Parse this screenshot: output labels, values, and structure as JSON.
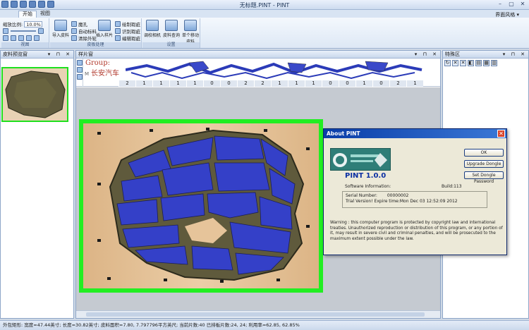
{
  "app": {
    "title": "无标题.PINT - PINT",
    "style_label": "界面风格 ▾"
  },
  "ribbon": {
    "tabs": [
      "开始",
      "视图"
    ],
    "zoom_label": "缩放比例:",
    "zoom_value": "10.0%",
    "groups": {
      "view_caption": "视图",
      "import_caption": "皮板处理",
      "camera_caption": "设置"
    },
    "buttons": {
      "import_leather": "导入皮料",
      "remove_hole": "魔孔",
      "auto_mark": "自动标料",
      "clear_outline": "清除外轮",
      "insert_piece": "插入样片",
      "draw_defect": "绘制瑕疵",
      "recognize_defect": "识别瑕疵",
      "edit_defect": "编辑瑕疵",
      "adjust_camera": "调校相机",
      "leather_inventory": "皮料查询",
      "single_move": "单个移动皮料"
    }
  },
  "left_panel": {
    "title": "皮料预览窗"
  },
  "center_panel": {
    "title": "样片窗",
    "group_label": "Group:",
    "group_name": "长安汽车",
    "strip_m": "M",
    "counts": [
      "2",
      "1",
      "1",
      "1",
      "1",
      "0",
      "0",
      "2",
      "2",
      "1",
      "1",
      "1",
      "0",
      "0",
      "1",
      "0",
      "2",
      "1"
    ]
  },
  "right_panel": {
    "title": "特殊区",
    "tools": [
      "↻",
      "✕",
      "✕",
      "◧",
      "▤",
      "▦",
      "▥"
    ]
  },
  "about": {
    "title": "About PINT",
    "close": "✕",
    "product": "PINT 1.0.0",
    "software_info": "Software Information:",
    "build": "Build:113",
    "serial_label": "Serial Number:",
    "serial_value": "00000002",
    "trial": "Trial Version! Expire time:Mon Dec 03 12:52:09 2012",
    "warning": "Warning : this computer program is protected by copyright law and international treaties. Unauthorized  reproduction or distribution of this program, or any portion of it, may result in severe civil and criminal penalties, and  will be prosecuted to the maximum extent possible under the law.",
    "buttons": {
      "ok": "OK",
      "upgrade": "Upgrade Dongle",
      "set_password": "Set Dongle Password"
    }
  },
  "status": {
    "text": "外包矩形: 宽度=47.44英寸; 长度=30.82英寸; 皮料面积=7.80, 7.797796平方英尺; 当前片数:40 已排板片数:24, 24; 利用率=62.85, 62.85%"
  }
}
